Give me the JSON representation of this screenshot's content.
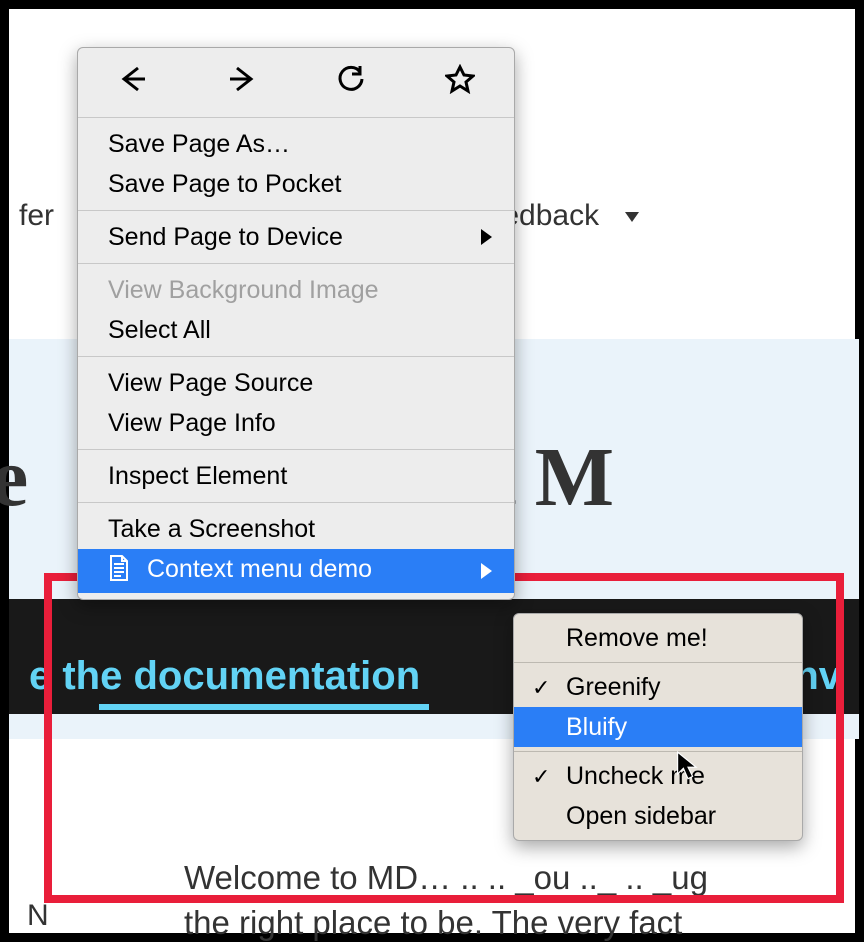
{
  "page": {
    "nav_left": "fer",
    "nav_right": "edback",
    "title_fragment_left": "e",
    "title_fragment_right": "bout M",
    "banner_take_screenshot": "Take a Screenshot",
    "banner_left": "e the documentation",
    "banner_right": "nv",
    "body_line1": "Welcome to MD… .. .. _ou .._ .. _ug",
    "body_line2": "the right place to be. The very fact",
    "body_left_fragment": "N"
  },
  "menu": {
    "groups": [
      {
        "items": [
          {
            "label": "Save Page As…",
            "key": "save_page_as"
          },
          {
            "label": "Save Page to Pocket",
            "key": "save_to_pocket"
          }
        ]
      },
      {
        "items": [
          {
            "label": "Send Page to Device",
            "key": "send_to_device",
            "submenu": true
          }
        ]
      },
      {
        "items": [
          {
            "label": "View Background Image",
            "key": "view_bg_image",
            "disabled": true
          },
          {
            "label": "Select All",
            "key": "select_all"
          }
        ]
      },
      {
        "items": [
          {
            "label": "View Page Source",
            "key": "view_source"
          },
          {
            "label": "View Page Info",
            "key": "view_info"
          }
        ]
      },
      {
        "items": [
          {
            "label": "Inspect Element",
            "key": "inspect"
          }
        ]
      },
      {
        "items": [
          {
            "label": "Take a Screenshot",
            "key": "screenshot"
          },
          {
            "label": "Context menu demo",
            "key": "ctx_demo",
            "submenu": true,
            "selected": true,
            "icon": "document"
          }
        ]
      }
    ]
  },
  "submenu": {
    "groups": [
      {
        "items": [
          {
            "label": "Remove me!",
            "key": "remove_me"
          }
        ]
      },
      {
        "items": [
          {
            "label": "Greenify",
            "key": "greenify",
            "checked": true
          },
          {
            "label": "Bluify",
            "key": "bluify",
            "selected": true
          }
        ]
      },
      {
        "items": [
          {
            "label": "Uncheck me",
            "key": "uncheck_me",
            "checked": true
          },
          {
            "label": "Open sidebar",
            "key": "open_sidebar"
          }
        ]
      }
    ]
  }
}
